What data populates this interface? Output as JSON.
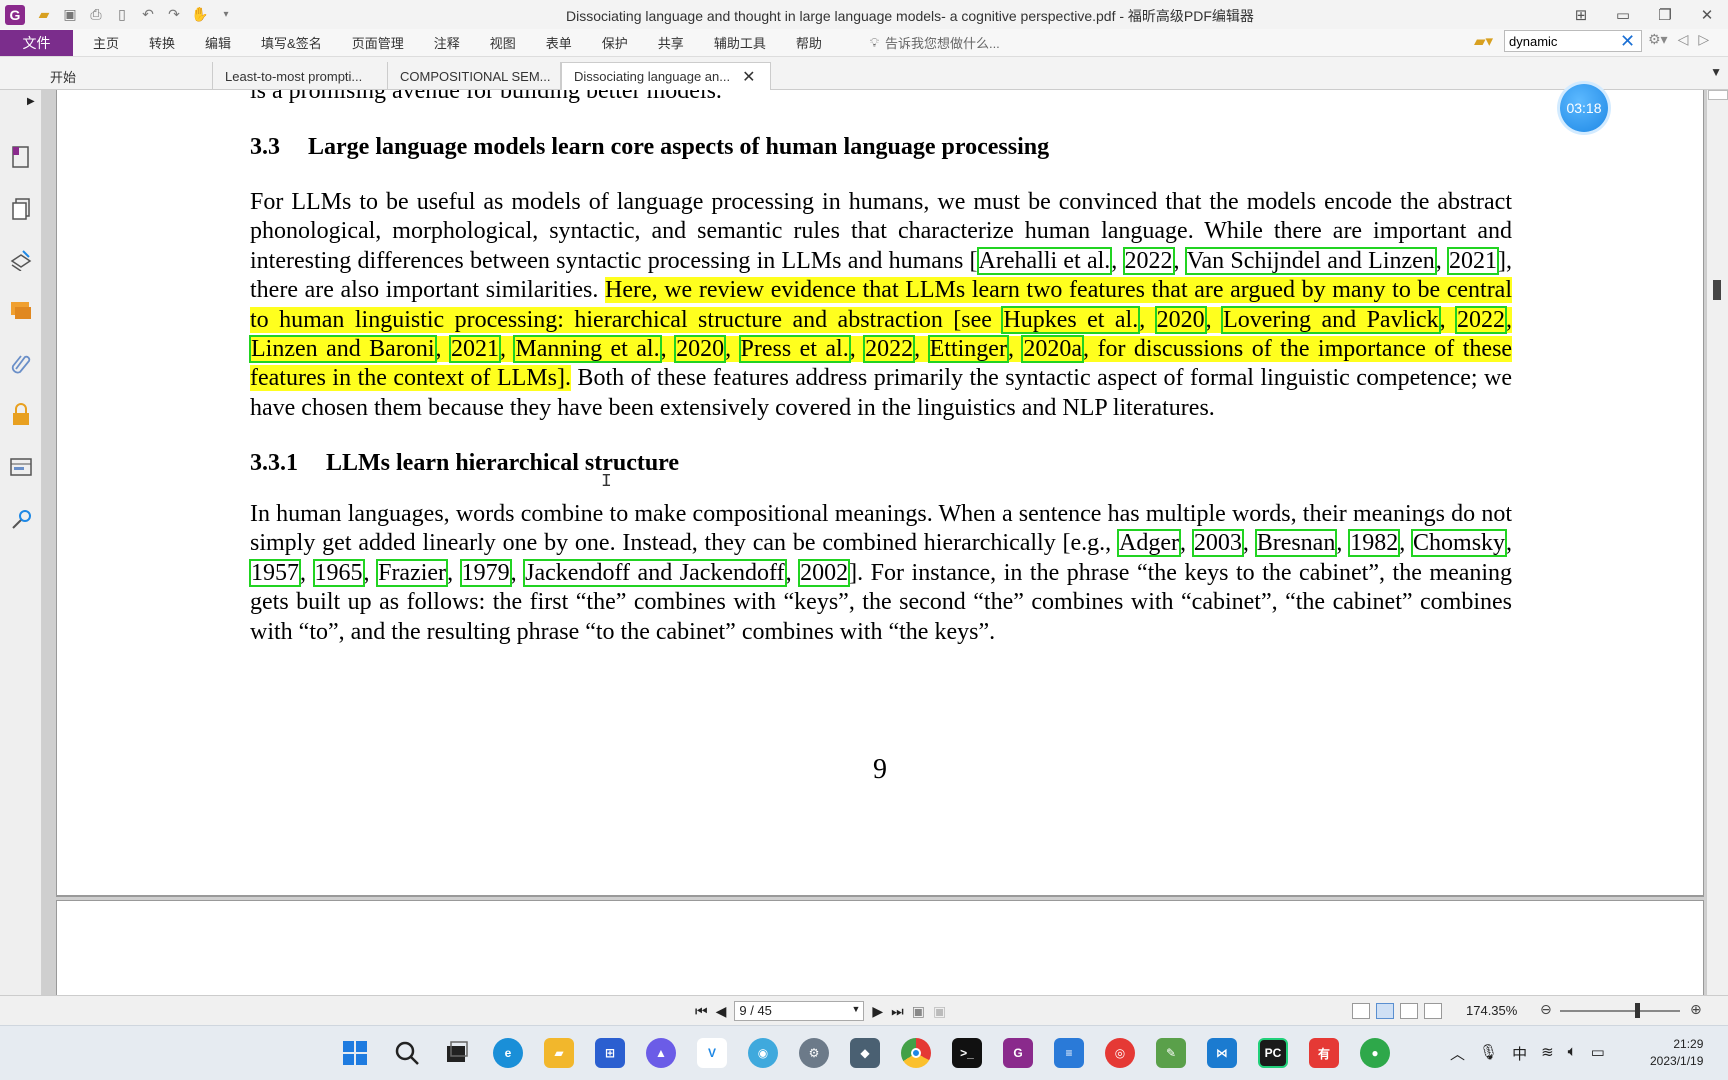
{
  "window": {
    "title": "Dissociating language and thought in large language models- a cognitive perspective.pdf - 福昕高级PDF编辑器"
  },
  "menu": {
    "file": "文件",
    "items": [
      "主页",
      "转换",
      "编辑",
      "填写&签名",
      "页面管理",
      "注释",
      "视图",
      "表单",
      "保护",
      "共享",
      "辅助工具",
      "帮助"
    ],
    "tell_me": "告诉我您想做什么..."
  },
  "search": {
    "value": "dynamic"
  },
  "tabs": [
    {
      "label": "开始"
    },
    {
      "label": "Least-to-most prompti..."
    },
    {
      "label": "COMPOSITIONAL SEM..."
    },
    {
      "label": "Dissociating language an..."
    }
  ],
  "timer": "03:18",
  "doc": {
    "cut_line": "is a promising avenue for building better models.",
    "sec33": {
      "num": "3.3",
      "title": "Large language models learn core aspects of human language processing"
    },
    "p1": {
      "a": "For LLMs to be useful as models of language processing in humans, we must be convinced that the models encode the abstract phonological, morphological, syntactic, and semantic rules that characterize human language. While there are important and interesting differences between syntactic processing in LLMs and humans [",
      "c1": "Arehalli et al.",
      "c2": "2022",
      "c3": "Van Schijndel and Linzen",
      "c4": "2021",
      "b": "], there are also important similarities. ",
      "h1": "Here, we review evidence that LLMs learn two features that are argued by many to be central to human linguistic processing: hierarchical structure and abstraction [see ",
      "c5": "Hupkes et al.",
      "c6": "2020",
      "c7": "Lovering and Pavlick",
      "c8": "2022",
      "c9": "Linzen and Baroni",
      "c10": "2021",
      "c11": "Manning et al.",
      "c12": "2020",
      "c13": "Press et al.",
      "c14": "2022",
      "c15": "Ettinger",
      "c16": "2020a",
      "h2": ", for discussions of the importance of these features in the context of LLMs].",
      "tail": " Both of these features address primarily the syntactic aspect of formal linguistic competence; we have chosen them because they have been extensively covered in the linguistics and NLP literatures."
    },
    "sec331": {
      "num": "3.3.1",
      "title": "LLMs learn hierarchical structure"
    },
    "p2": {
      "a": "In human languages, words combine to make compositional meanings. When a sentence has multiple words, their meanings do not simply get added linearly one by one. Instead, they can be combined hierarchically [e.g., ",
      "c1": "Adger",
      "c2": "2003",
      "c3": "Bresnan",
      "c4": "1982",
      "c5": "Chomsky",
      "c6": "1957",
      "c7": "1965",
      "c8": "Frazier",
      "c9": "1979",
      "c10": "Jackendoff and Jackendoff",
      "c11": "2002",
      "b": "]. For instance, in the phrase “the keys to the cabinet”, the meaning gets built up as follows: the first “the” combines with “keys”, the second “the” combines with “cabinet”, “the cabinet” combines with “to”, and the resulting phrase “to the cabinet” combines with “the keys”."
    },
    "page_number": "9"
  },
  "status": {
    "page_indicator": "9 / 45",
    "zoom": "174.35%"
  },
  "taskbar": {
    "clock_time": "21:29",
    "clock_date": "2023/1/19",
    "ime": "中"
  }
}
